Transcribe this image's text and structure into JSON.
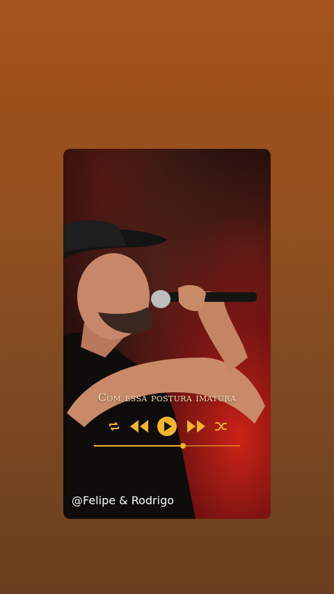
{
  "story": {
    "lyric": "Com essa postura imatura",
    "handle": "@Felipe & Rodrigo"
  },
  "player": {
    "progress": 0.61,
    "accent_color": "#f3b62b",
    "icons": [
      "repeat-icon",
      "rewind-icon",
      "play-icon",
      "fast-forward-icon",
      "shuffle-icon"
    ]
  }
}
